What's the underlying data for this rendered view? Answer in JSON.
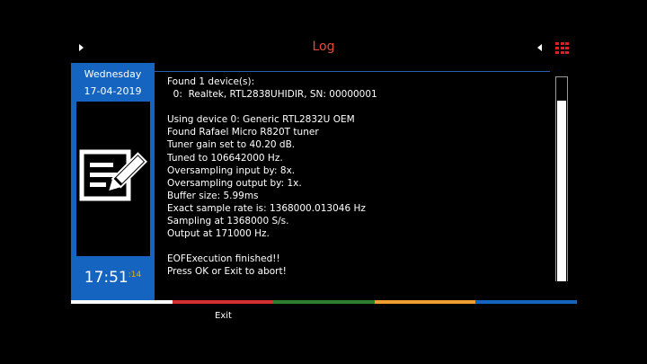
{
  "header": {
    "title": "Log"
  },
  "sidebar": {
    "day": "Wednesday",
    "date": "17-04-2019",
    "time_hm": "17:51",
    "time_seconds": ":14",
    "icon": "notepad-pencil-icon",
    "background_color": "#1565c0"
  },
  "log": {
    "lines": [
      "Found 1 device(s):",
      "  0:  Realtek, RTL2838UHIDIR, SN: 00000001",
      "",
      "Using device 0: Generic RTL2832U OEM",
      "Found Rafael Micro R820T tuner",
      "Tuner gain set to 40.20 dB.",
      "Tuned to 106642000 Hz.",
      "Oversampling input by: 8x.",
      "Oversampling output by: 1x.",
      "Buffer size: 5.99ms",
      "Exact sample rate is: 1368000.013046 Hz",
      "Sampling at 1368000 S/s.",
      "Output at 171000 Hz.",
      "",
      "EOFExecution finished!!",
      "Press OK or Exit to abort!"
    ]
  },
  "footer": {
    "colors": [
      "#ffffff",
      "#d32f2f",
      "#2e7d32",
      "#f0a030",
      "#1565c0"
    ],
    "exit_label": "Exit"
  }
}
